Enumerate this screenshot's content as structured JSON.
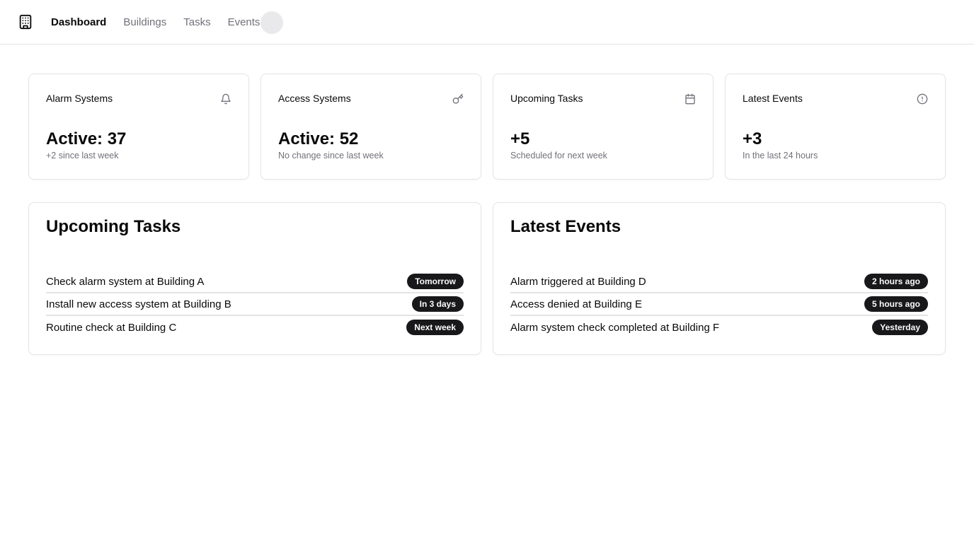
{
  "nav": {
    "items": [
      {
        "label": "Dashboard",
        "active": true
      },
      {
        "label": "Buildings",
        "active": false
      },
      {
        "label": "Tasks",
        "active": false
      },
      {
        "label": "Events",
        "active": false
      }
    ],
    "logo_icon": "building-icon"
  },
  "stats": [
    {
      "title": "Alarm Systems",
      "icon": "bell-icon",
      "value": "Active: 37",
      "sub": "+2 since last week"
    },
    {
      "title": "Access Systems",
      "icon": "key-icon",
      "value": "Active: 52",
      "sub": "No change since last week"
    },
    {
      "title": "Upcoming Tasks",
      "icon": "calendar-icon",
      "value": "+5",
      "sub": "Scheduled for next week"
    },
    {
      "title": "Latest Events",
      "icon": "alert-circle-icon",
      "value": "+3",
      "sub": "In the last 24 hours"
    }
  ],
  "tasks": {
    "title": "Upcoming Tasks",
    "items": [
      {
        "text": "Check alarm system at Building A",
        "badge": "Tomorrow"
      },
      {
        "text": "Install new access system at Building B",
        "badge": "In 3 days"
      },
      {
        "text": "Routine check at Building C",
        "badge": "Next week"
      }
    ]
  },
  "events": {
    "title": "Latest Events",
    "items": [
      {
        "text": "Alarm triggered at Building D",
        "badge": "2 hours ago"
      },
      {
        "text": "Access denied at Building E",
        "badge": "5 hours ago"
      },
      {
        "text": "Alarm system check completed at Building F",
        "badge": "Yesterday"
      }
    ]
  },
  "colors": {
    "text": "#09090b",
    "muted": "#71717a",
    "border": "#e4e4e7",
    "badge_bg": "#18181b",
    "badge_text": "#fafafa"
  }
}
